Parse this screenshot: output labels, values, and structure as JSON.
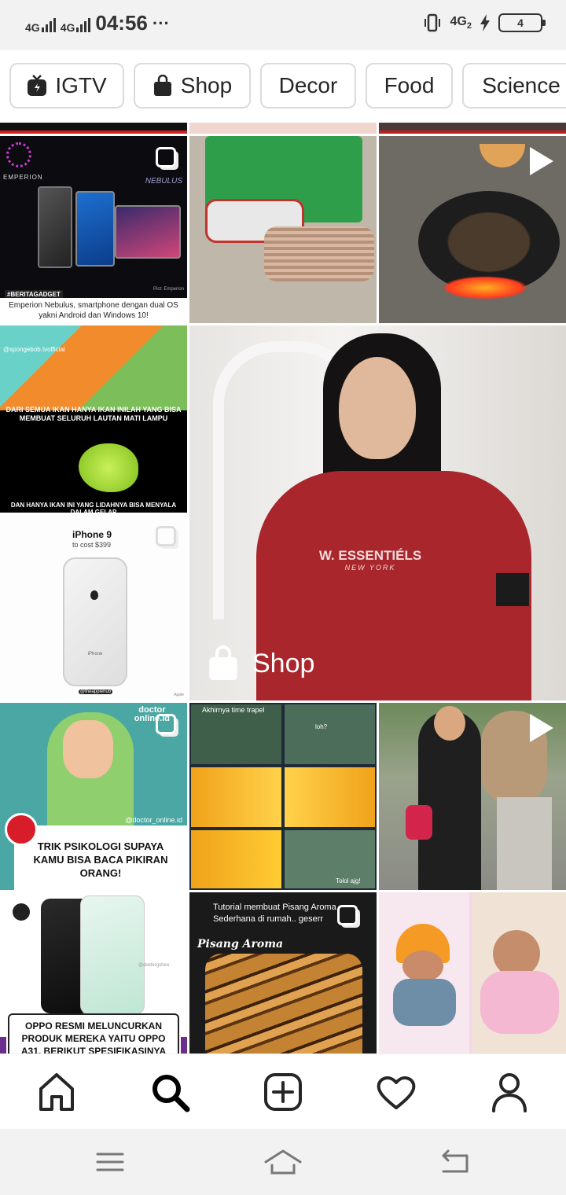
{
  "status": {
    "sim1": "4G",
    "sim2": "4G",
    "time": "04:56",
    "more": "···",
    "right_network": "4G",
    "right_network_sub": "2",
    "battery_level": "4",
    "icons": [
      "vibrate-icon",
      "lightning-charging-icon",
      "battery-icon"
    ]
  },
  "topics": [
    {
      "label": "IGTV",
      "icon": "igtv-icon"
    },
    {
      "label": "Shop",
      "icon": "shopping-bag-icon"
    },
    {
      "label": "Decor"
    },
    {
      "label": "Food"
    },
    {
      "label": "Science"
    }
  ],
  "tiles": {
    "emperion": {
      "brand": "EMPERION",
      "model": "NEBULUS",
      "tag": "#BERITAGADGET",
      "pict": "Pict: Emperion",
      "caption": "Emperion Nebulus, smartphone dengan dual OS yakni Android dan Windows 10!"
    },
    "spongebob": {
      "handle": "@spongebob.tvofficial",
      "top_text": "DARI SEMUA IKAN HANYA IKAN INILAH YANG BISA MEMBUAT SELURUH LAUTAN MATI LAMPU",
      "bottom_text": "DAN HANYA IKAN INI YANG LIDAHNYA BISA MENYALA DALAM GELAP"
    },
    "iphone": {
      "title": "iPhone 9",
      "subtitle": "to cost $399",
      "device_label": "iPhone",
      "handle": "@theapplehub",
      "credit": "Apple"
    },
    "shop_post": {
      "shop_label": "Shop",
      "shirt_brand": "W. ESSENTIÉLS",
      "shirt_city": "NEW YORK"
    },
    "doctor": {
      "brand_line1": "doctor",
      "brand_line2": "online.id",
      "handle": "@doctor_online.id",
      "caption": "TRIK PSIKOLOGI SUPAYA KAMU BISA BACA PIKIRAN ORANG!"
    },
    "squidward": {
      "top": "Akhirnya time trapel",
      "mid": "loh?",
      "bottom": "Tolol ajg!"
    },
    "oppo": {
      "handle": "@doktergstore",
      "caption": "OPPO RESMI MELUNCURKAN PRODUK MEREKA YAITU OPPO A31, BERIKUT SPESIFIKASINYA"
    },
    "pisang": {
      "header": "Tutorial membuat Pisang Aroma Sederhana di rumah.. geserr",
      "title": "Pisang Aroma"
    }
  },
  "bottom_nav": [
    {
      "name": "home",
      "icon": "home-icon"
    },
    {
      "name": "search",
      "icon": "search-icon"
    },
    {
      "name": "new-post",
      "icon": "add-post-icon"
    },
    {
      "name": "activity",
      "icon": "heart-icon"
    },
    {
      "name": "profile",
      "icon": "profile-icon"
    }
  ],
  "system_nav": [
    "menu-icon",
    "home-icon",
    "back-icon"
  ]
}
